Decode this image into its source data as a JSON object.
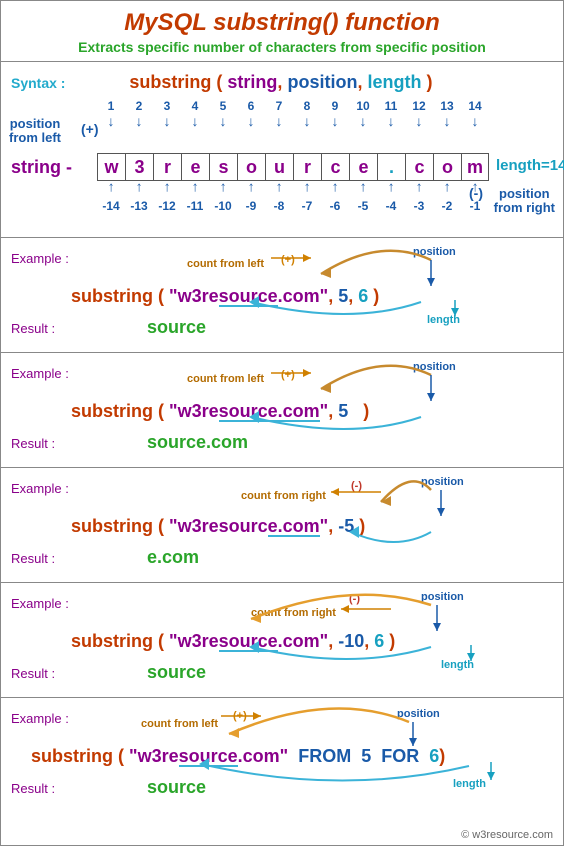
{
  "title": "MySQL substring() function",
  "subtitle": "Extracts specific number of characters from specific position",
  "syntax": {
    "label": "Syntax :",
    "fn": "substring",
    "open": "(",
    "arg_string": "string",
    "arg_position": "position",
    "arg_length": "length",
    "close": ")"
  },
  "diagram": {
    "pos_from_left_1": "position",
    "pos_from_left_2": "from left",
    "plus": "(+)",
    "string_label": "string -",
    "chars": [
      "w",
      "3",
      "r",
      "e",
      "s",
      "o",
      "u",
      "r",
      "c",
      "e",
      ".",
      "c",
      "o",
      "m"
    ],
    "top_nums": [
      "1",
      "2",
      "3",
      "4",
      "5",
      "6",
      "7",
      "8",
      "9",
      "10",
      "11",
      "12",
      "13",
      "14"
    ],
    "bot_nums": [
      "-14",
      "-13",
      "-12",
      "-11",
      "-10",
      "-9",
      "-8",
      "-7",
      "-6",
      "-5",
      "-4",
      "-3",
      "-2",
      "-1"
    ],
    "length_label": "length=14",
    "minus": "(-)",
    "pos_from_right_1": "position",
    "pos_from_right_2": "from right"
  },
  "examples": [
    {
      "label": "Example :",
      "count_hint": "count from left",
      "sign": "(+)",
      "pos_label": "position",
      "len_label": "length",
      "fn": "substring",
      "open": "(",
      "str": "\"w3resource.com\"",
      "arg2": "5",
      "arg3": "6",
      "close": ")",
      "result_label": "Result :",
      "result": "source"
    },
    {
      "label": "Example :",
      "count_hint": "count from left",
      "sign": "(+)",
      "pos_label": "position",
      "len_label": "",
      "fn": "substring",
      "open": "(",
      "str": "\"w3resource.com\"",
      "arg2": "5",
      "arg3": "",
      "close": ")",
      "result_label": "Result :",
      "result": "source.com"
    },
    {
      "label": "Example :",
      "count_hint": "count from right",
      "sign": "(-)",
      "pos_label": "position",
      "len_label": "",
      "fn": "substring",
      "open": "(",
      "str": "\"w3resource.com\"",
      "arg2": "-5",
      "arg3": "",
      "close": ")",
      "result_label": "Result :",
      "result": "e.com"
    },
    {
      "label": "Example :",
      "count_hint": "count from right",
      "sign": "(-)",
      "pos_label": "position",
      "len_label": "length",
      "fn": "substring",
      "open": "(",
      "str": "\"w3resource.com\"",
      "arg2": "-10",
      "arg3": "6",
      "close": ")",
      "result_label": "Result :",
      "result": "source"
    },
    {
      "label": "Example :",
      "count_hint": "count from left",
      "sign": "(+)",
      "pos_label": "position",
      "len_label": "length",
      "fn": "substring",
      "open": "(",
      "str": "\"w3resource.com\"",
      "kw_from": "FROM",
      "arg2": "5",
      "kw_for": "FOR",
      "arg3": "6",
      "close": ")",
      "result_label": "Result :",
      "result": "source"
    }
  ],
  "footer": "© w3resource.com"
}
